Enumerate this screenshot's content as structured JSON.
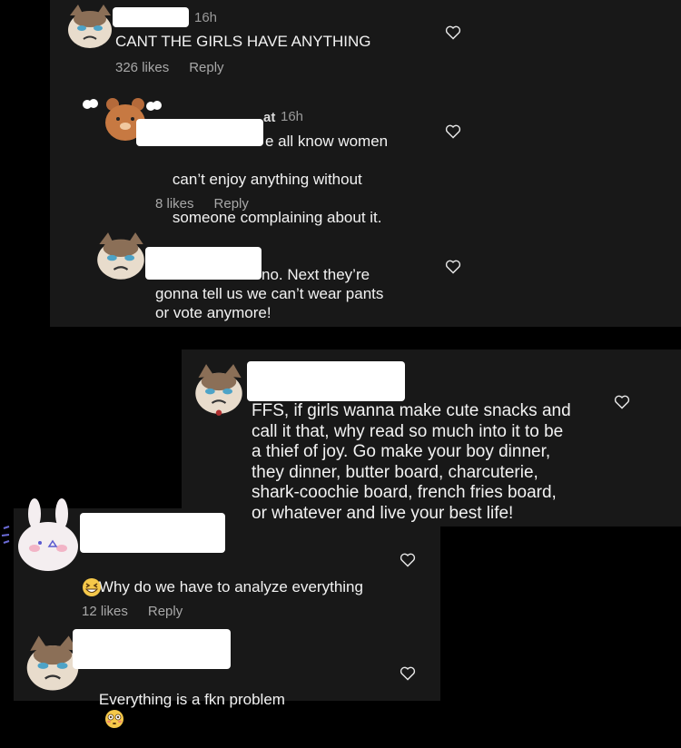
{
  "comments": [
    {
      "time": "16h",
      "text": "CANT THE GIRLS HAVE ANYTHING",
      "likes": "326 likes",
      "reply": "Reply"
    },
    {
      "time": "16h",
      "username_fragment": "at",
      "text": "We all know women\ncan’t enjoy anything without\nsomeone complaining about it.",
      "text_first_line_visible": "e all know women",
      "likes": "8 likes",
      "reply": "Reply"
    },
    {
      "text_first_line_visible": "no. Next they’re",
      "text_rest": "gonna tell us we can’t wear pants\nor vote anymore!"
    },
    {
      "text": "FFS, if girls wanna make cute snacks and\ncall it that, why read so much into it to be\na thief of joy. Go make your boy dinner,\nthey dinner, butter board, charcuterie,\nshark-coochie board, french fries board,\nor whatever and live your best life!"
    },
    {
      "text": "Why do we have to analyze everything",
      "emoji": "grinning-squint-emoji",
      "likes": "12 likes",
      "reply": "Reply"
    },
    {
      "text": "Everything is a fkn problem",
      "emoji": "flushed-emoji"
    }
  ],
  "colors": {
    "background": "#000000",
    "panel": "#181818",
    "text": "#f2f2f2",
    "muted": "#a8a8a8"
  }
}
